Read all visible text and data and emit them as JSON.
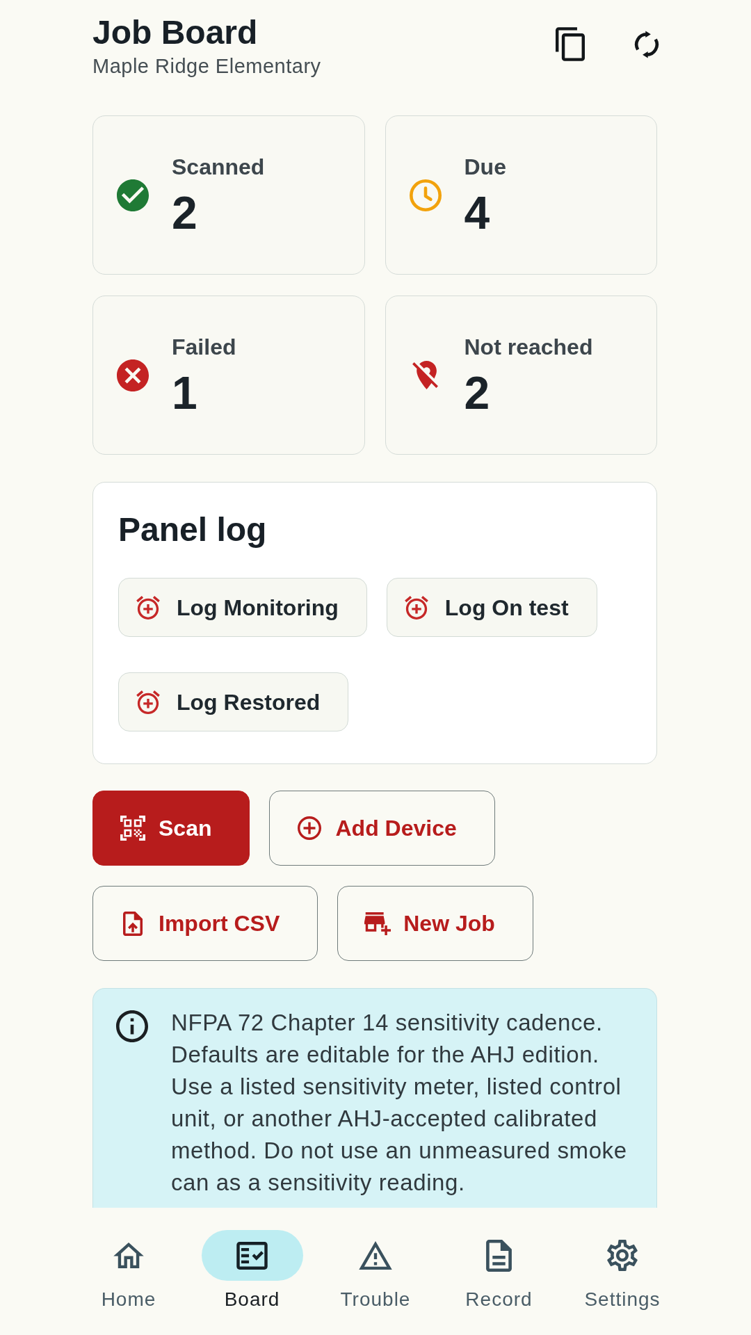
{
  "header": {
    "title": "Job Board",
    "subtitle": "Maple Ridge Elementary"
  },
  "stats": [
    {
      "kind": "scanned",
      "label": "Scanned",
      "value": "2"
    },
    {
      "kind": "due",
      "label": "Due",
      "value": "4"
    },
    {
      "kind": "failed",
      "label": "Failed",
      "value": "1"
    },
    {
      "kind": "unreached",
      "label": "Not reached",
      "value": "2"
    }
  ],
  "panel_log": {
    "title": "Panel log",
    "buttons": [
      {
        "label": "Log Monitoring"
      },
      {
        "label": "Log On test"
      },
      {
        "label": "Log Restored"
      }
    ]
  },
  "actions": [
    {
      "kind": "scan",
      "label": "Scan"
    },
    {
      "kind": "add",
      "label": "Add Device"
    },
    {
      "kind": "import",
      "label": "Import CSV"
    },
    {
      "kind": "create",
      "label": "New Job"
    }
  ],
  "notice": {
    "text": "NFPA 72 Chapter 14 sensitivity cadence. Defaults are editable for the AHJ edition. Use a listed sensitivity meter, listed control unit, or another AHJ-accepted calibrated method. Do not use an unmeasured smoke can as a sensitivity reading."
  },
  "bottom_nav": [
    {
      "kind": "home",
      "label": "Home",
      "selected": false
    },
    {
      "kind": "board",
      "label": "Board",
      "selected": true
    },
    {
      "kind": "trouble",
      "label": "Trouble",
      "selected": false
    },
    {
      "kind": "record",
      "label": "Record",
      "selected": false
    },
    {
      "kind": "settings",
      "label": "Settings",
      "selected": false
    }
  ]
}
